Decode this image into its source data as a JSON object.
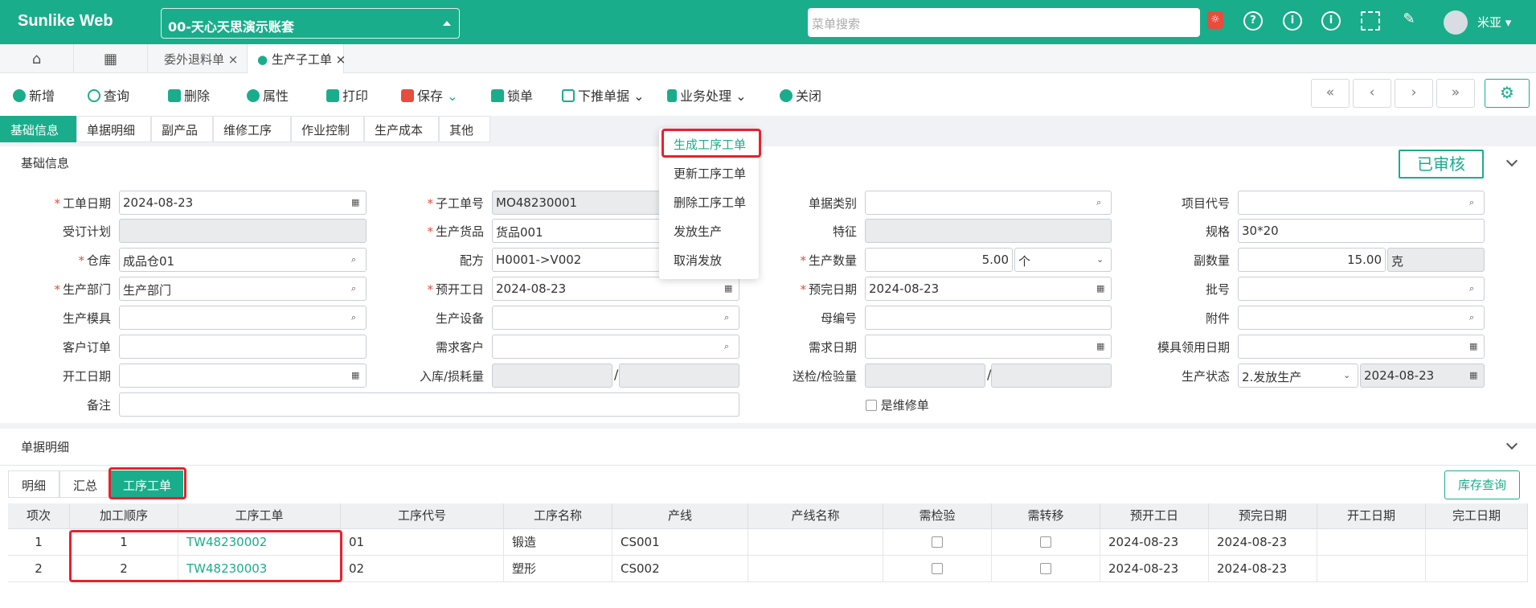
{
  "app": {
    "brand": "Sunlike Web",
    "account": "00-天心天思演示账套",
    "search_placeholder": "菜单搜索",
    "user": "米亚"
  },
  "tabs": [
    {
      "label": "委外退料单"
    },
    {
      "label": "生产子工单"
    }
  ],
  "toolbar": {
    "add": "新增",
    "query": "查询",
    "delete": "删除",
    "props": "属性",
    "print": "打印",
    "save": "保存",
    "lock": "锁单",
    "push": "下推单据",
    "business": "业务处理",
    "close": "关闭"
  },
  "nav": {
    "first": "«",
    "prev": "‹",
    "next": "›",
    "last": "»"
  },
  "subtabs": [
    "基础信息",
    "单据明细",
    "副产品",
    "维修工序",
    "作业控制",
    "生产成本",
    "其他"
  ],
  "section": {
    "title": "基础信息",
    "status": "已审核"
  },
  "menu": [
    "生成工序工单",
    "更新工序工单",
    "删除工序工单",
    "发放生产",
    "取消发放"
  ],
  "form": {
    "order_date": {
      "label": "工单日期",
      "value": "2024-08-23"
    },
    "sub_no": {
      "label": "子工单号",
      "value": "MO48230001"
    },
    "doc_type": {
      "label": "单据类别",
      "value": ""
    },
    "project": {
      "label": "项目代号",
      "value": ""
    },
    "plan": {
      "label": "受订计划",
      "value": ""
    },
    "goods": {
      "label": "生产货品",
      "value": "货品001"
    },
    "feature": {
      "label": "特征",
      "value": ""
    },
    "spec": {
      "label": "规格",
      "value": "30*20"
    },
    "warehouse": {
      "label": "仓库",
      "value": "成品仓01"
    },
    "formula": {
      "label": "配方",
      "value": "H0001->V002"
    },
    "qty": {
      "label": "生产数量",
      "value": "5.00",
      "unit": "个"
    },
    "sub_qty": {
      "label": "副数量",
      "value": "15.00",
      "unit": "克"
    },
    "dept": {
      "label": "生产部门",
      "value": "生产部门"
    },
    "start": {
      "label": "预开工日",
      "value": "2024-08-23"
    },
    "end": {
      "label": "预完日期",
      "value": "2024-08-23"
    },
    "batch": {
      "label": "批号",
      "value": ""
    },
    "mold": {
      "label": "生产模具",
      "value": ""
    },
    "device": {
      "label": "生产设备",
      "value": ""
    },
    "mother": {
      "label": "母编号",
      "value": ""
    },
    "attach": {
      "label": "附件",
      "value": ""
    },
    "cust_order": {
      "label": "客户订单",
      "value": ""
    },
    "demand_cust": {
      "label": "需求客户",
      "value": ""
    },
    "demand_date": {
      "label": "需求日期",
      "value": ""
    },
    "mold_date": {
      "label": "模具领用日期",
      "value": ""
    },
    "begin_date": {
      "label": "开工日期",
      "value": ""
    },
    "inbound": {
      "label": "入库/损耗量",
      "value": ""
    },
    "inspect": {
      "label": "送检/检验量",
      "value": ""
    },
    "status": {
      "label": "生产状态",
      "value": "2.发放生产",
      "date": "2024-08-23"
    },
    "remark": {
      "label": "备注",
      "value": ""
    },
    "repair": {
      "label": "是维修单"
    }
  },
  "detail": {
    "title": "单据明细",
    "tabs": [
      "明细",
      "汇总",
      "工序工单"
    ],
    "stock_btn": "库存查询",
    "columns": [
      "项次",
      "加工顺序",
      "工序工单",
      "工序代号",
      "工序名称",
      "产线",
      "产线名称",
      "需检验",
      "需转移",
      "预开工日",
      "预完日期",
      "开工日期",
      "完工日期"
    ],
    "rows": [
      [
        "1",
        "1",
        "TW48230002",
        "01",
        "锻造",
        "CS001",
        "",
        "",
        "",
        "2024-08-23",
        "2024-08-23",
        "",
        ""
      ],
      [
        "2",
        "2",
        "TW48230003",
        "02",
        "塑形",
        "CS002",
        "",
        "",
        "",
        "2024-08-23",
        "2024-08-23",
        "",
        ""
      ]
    ]
  }
}
